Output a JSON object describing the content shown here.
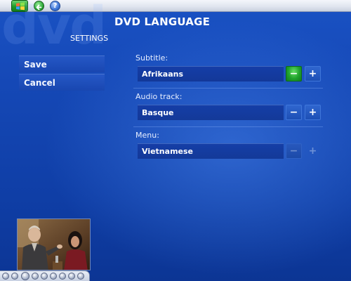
{
  "watermark": "dvd",
  "page_title": "DVD LANGUAGE",
  "section_label": "SETTINGS",
  "sidebar": {
    "save_label": "Save",
    "cancel_label": "Cancel"
  },
  "fields": [
    {
      "label": "Subtitle:",
      "value": "Afrikaans",
      "focused_control": "minus"
    },
    {
      "label": "Audio track:",
      "value": "Basque"
    },
    {
      "label": "Menu:",
      "value": "Vietnamese"
    }
  ],
  "controls": {
    "minus": "−",
    "plus": "+"
  },
  "colors": {
    "background": "#1548b6",
    "focus": "#1fa22c",
    "topbar": "#dfe4ee"
  },
  "icons": {
    "start": "windows-flag-icon",
    "back": "back-arrow-icon",
    "help": "help-icon"
  }
}
